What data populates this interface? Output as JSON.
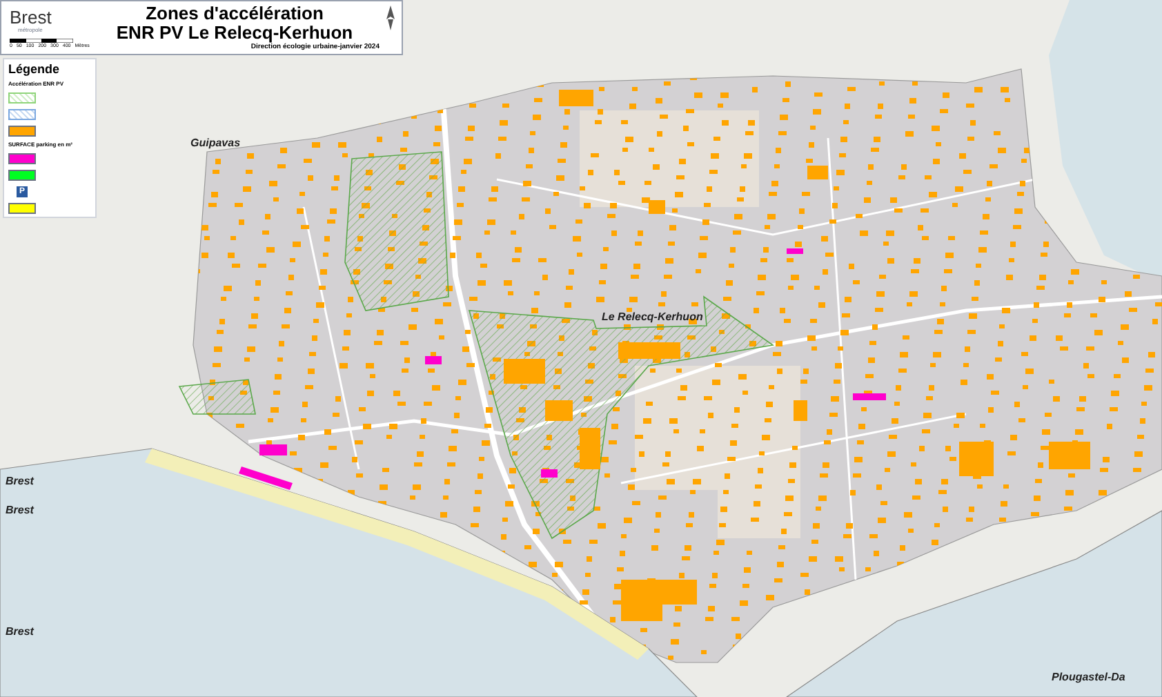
{
  "header": {
    "logo": {
      "name": "Brest",
      "subtitle": "métropole"
    },
    "title_lines": [
      "Zones d'accélération",
      "ENR PV Le Relecq-Kerhuon"
    ],
    "scale_ticks": [
      "0",
      "50",
      "100",
      "200",
      "300",
      "400"
    ],
    "scale_unit": "Mètres",
    "credit": "Direction écologie urbaine-janvier 2024"
  },
  "legend": {
    "title": "Légende",
    "sections": [
      {
        "heading": "Accélération ENR PV",
        "items": [
          {
            "kind": "hatch",
            "color": "#8fd47a"
          },
          {
            "kind": "hatch",
            "color": "#7aa7e0"
          },
          {
            "kind": "fill",
            "color": "#ffa500"
          }
        ]
      },
      {
        "heading": "SURFACE parking en m²",
        "items": [
          {
            "kind": "fill",
            "color": "#ff00cc"
          },
          {
            "kind": "fill",
            "color": "#00ff22"
          },
          {
            "kind": "parking",
            "label": "P"
          },
          {
            "kind": "fill",
            "color": "#ffff00"
          }
        ]
      }
    ]
  },
  "map_labels": [
    "Guipavas",
    "Le Relecq-Kerhuon",
    "Brest",
    "Brest",
    "Brest",
    "Plougastel-Da"
  ]
}
